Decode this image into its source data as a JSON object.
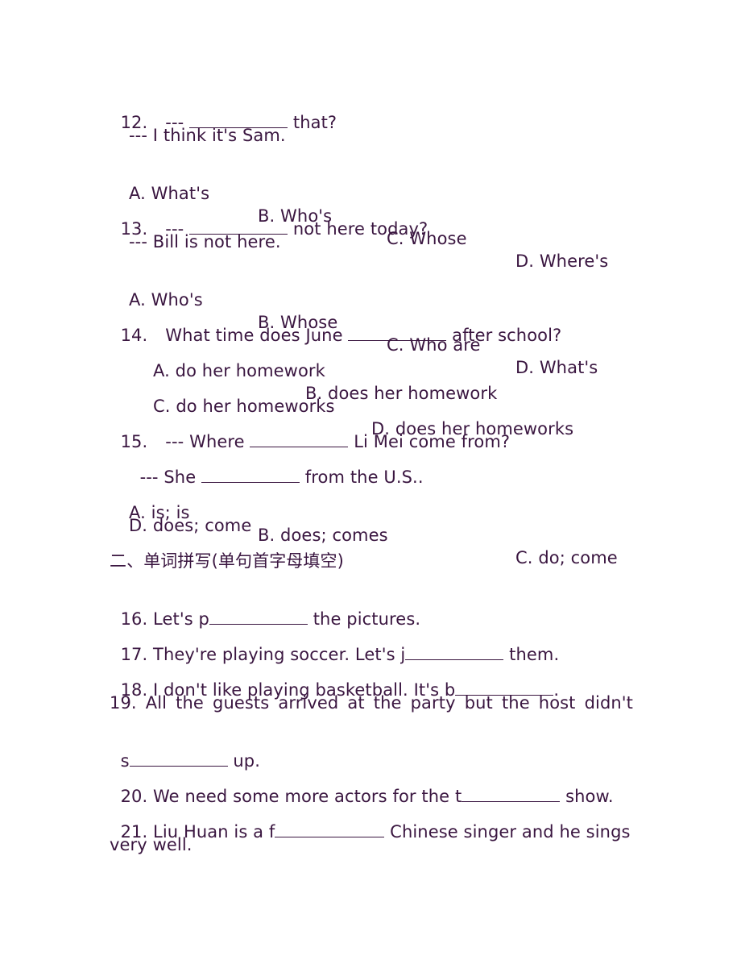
{
  "questions": {
    "q12": {
      "num": "12.",
      "prefix": "---",
      "suffix": "that?",
      "answer_line": "--- I think it's Sam.",
      "options": [
        "A. What's",
        "B. Who's",
        "C. Whose",
        "D. Where's"
      ]
    },
    "q13": {
      "num": "13.",
      "prefix": "---",
      "suffix": "not here today?",
      "answer_line": "--- Bill is not here.",
      "options": [
        "A. Who's",
        "B. Whose",
        "C. Who are",
        "D. What's"
      ]
    },
    "q14": {
      "num": "14.",
      "prefix": "What time does June",
      "suffix": "after school?",
      "options": [
        "A. do her homework",
        "B. does her homework",
        "C. do her homeworks",
        "D. does her homeworks"
      ]
    },
    "q15": {
      "num": "15.",
      "prefix": "--- Where",
      "suffix": "Li Mei come from?",
      "answer_prefix": "--- She",
      "answer_suffix": "from the U.S..",
      "options": [
        "A. is; is",
        "B. does; comes",
        "C. do; come",
        "D. does; come"
      ]
    }
  },
  "section2": {
    "title": "二、单词拼写(单句首字母填空)",
    "items": [
      {
        "prefix": "16. Let's p",
        "suffix": " the pictures."
      },
      {
        "prefix": "17. They're playing soccer. Let's j",
        "suffix": " them."
      },
      {
        "prefix": "18. I don't like playing basketball. It's b",
        "suffix": "."
      },
      {
        "line1": "19. All the guests arrived at the party but the host didn't",
        "prefix": "s",
        "suffix": " up."
      },
      {
        "prefix": "20. We need some more actors for the t",
        "suffix": " show."
      },
      {
        "line1": "21. Liu Huan is a f",
        "line1_suffix": " Chinese singer and he sings",
        "line2": "very well."
      }
    ]
  }
}
